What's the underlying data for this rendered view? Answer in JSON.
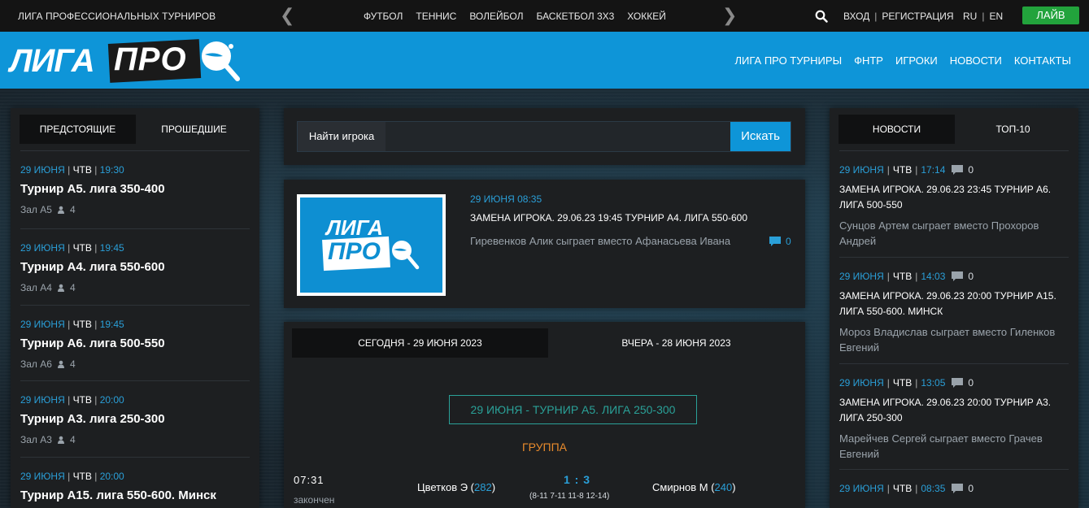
{
  "topbar": {
    "league": "ЛИГА ПРОФЕССИОНАЛЬНЫХ ТУРНИРОВ",
    "sports": [
      "ФУТБОЛ",
      "ТЕННИС",
      "ВОЛЕЙБОЛ",
      "БАСКЕТБОЛ 3Х3",
      "ХОККЕЙ"
    ],
    "login": "ВХОД",
    "register": "РЕГИСТРАЦИЯ",
    "lang_ru": "RU",
    "lang_en": "EN",
    "live": "ЛАЙВ"
  },
  "header": {
    "logo_liga": "ЛИГА",
    "logo_pro": "ПРО",
    "nav": [
      "ЛИГА ПРО ТУРНИРЫ",
      "ФНТР",
      "ИГРОКИ",
      "НОВОСТИ",
      "КОНТАКТЫ"
    ]
  },
  "left": {
    "tabs": [
      "ПРЕДСТОЯЩИЕ",
      "ПРОШЕДШИЕ"
    ],
    "tournaments": [
      {
        "date": "29 ИЮНЯ",
        "day": "ЧТВ",
        "time": "19:30",
        "title": "Турнир А5. лига 350-400",
        "hall": "Зал А5",
        "players": "4"
      },
      {
        "date": "29 ИЮНЯ",
        "day": "ЧТВ",
        "time": "19:45",
        "title": "Турнир А4. лига 550-600",
        "hall": "Зал А4",
        "players": "4"
      },
      {
        "date": "29 ИЮНЯ",
        "day": "ЧТВ",
        "time": "19:45",
        "title": "Турнир А6. лига 500-550",
        "hall": "Зал А6",
        "players": "4"
      },
      {
        "date": "29 ИЮНЯ",
        "day": "ЧТВ",
        "time": "20:00",
        "title": "Турнир А3. лига 250-300",
        "hall": "Зал А3",
        "players": "4"
      },
      {
        "date": "29 ИЮНЯ",
        "day": "ЧТВ",
        "time": "20:00",
        "title": "Турнир А15. лига 550-600. Минск",
        "hall": "",
        "players": ""
      }
    ]
  },
  "search": {
    "label": "Найти игрока",
    "placeholder": "",
    "button": "Искать"
  },
  "news_main": {
    "thumb_liga": "ЛИГА",
    "thumb_pro": "ПРО",
    "date": "29 ИЮНЯ 08:35",
    "title": "ЗАМЕНА ИГРОКА. 29.06.23 19:45 ТУРНИР А4. ЛИГА 550-600",
    "text": "Гиревенков Алик сыграет вместо Афанасьева Ивана",
    "comments": "0"
  },
  "matches": {
    "tab_today": "СЕГОДНЯ - 29 ИЮНЯ 2023",
    "tab_yesterday": "ВЧЕРА - 28 ИЮНЯ 2023",
    "tournament": "29 ИЮНЯ - ТУРНИР А5. ЛИГА 250-300",
    "group": "ГРУППА",
    "match": {
      "time": "07:31",
      "status": "закончен",
      "player1": "Цветков Э",
      "rating1": "282",
      "score": "1 : 3",
      "sets": "(8-11 7-11 11-8 12-14)",
      "player2": "Смирнов М",
      "rating2": "240"
    }
  },
  "right": {
    "tabs": [
      "НОВОСТИ",
      "ТОП-10"
    ],
    "items": [
      {
        "date": "29 ИЮНЯ",
        "day": "ЧТВ",
        "time": "17:14",
        "comments": "0",
        "title": "ЗАМЕНА ИГРОКА. 29.06.23 23:45 ТУРНИР А6. ЛИГА 500-550",
        "text": "Сунцов Артем сыграет вместо Прохоров Андрей"
      },
      {
        "date": "29 ИЮНЯ",
        "day": "ЧТВ",
        "time": "14:03",
        "comments": "0",
        "title": "ЗАМЕНА ИГРОКА. 29.06.23 20:00 ТУРНИР А15. ЛИГА 550-600. МИНСК",
        "text": "Мороз Владислав сыграет вместо Гиленков Евгений"
      },
      {
        "date": "29 ИЮНЯ",
        "day": "ЧТВ",
        "time": "13:05",
        "comments": "0",
        "title": "ЗАМЕНА ИГРОКА. 29.06.23 20:00 ТУРНИР А3. ЛИГА 250-300",
        "text": "Марейчев Сергей сыграет вместо Грачев Евгений"
      },
      {
        "date": "29 ИЮНЯ",
        "day": "ЧТВ",
        "time": "08:35",
        "comments": "0",
        "title": "",
        "text": ""
      }
    ]
  }
}
